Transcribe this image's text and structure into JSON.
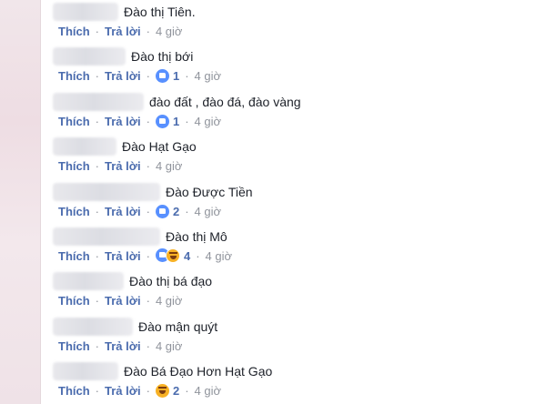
{
  "labels": {
    "like": "Thích",
    "reply": "Trả lời",
    "sep": "·"
  },
  "comments": [
    {
      "text": "Đào thị Tiên.",
      "reaction": null,
      "time": "4 giờ"
    },
    {
      "text": "Đào thị bới",
      "reaction": {
        "type": "like",
        "count": "1"
      },
      "time": "4 giờ"
    },
    {
      "text": "đào đất , đào đá, đào vàng",
      "reaction": {
        "type": "like",
        "count": "1"
      },
      "time": "4 giờ"
    },
    {
      "text": "Đào Hạt Gạo",
      "reaction": null,
      "time": "4 giờ"
    },
    {
      "text": "Đào Được Tiền",
      "reaction": {
        "type": "like",
        "count": "2"
      },
      "time": "4 giờ"
    },
    {
      "text": "Đào thị Mô",
      "reaction": {
        "type": "like-haha",
        "count": "4"
      },
      "time": "4 giờ"
    },
    {
      "text": "Đào thị bá đạo",
      "reaction": null,
      "time": "4 giờ"
    },
    {
      "text": "Đào mận quýt",
      "reaction": null,
      "time": "4 giờ"
    },
    {
      "text": "Đào Bá Đạo Hơn Hạt Gạo",
      "reaction": {
        "type": "haha",
        "count": "2"
      },
      "time": "4 giờ"
    }
  ]
}
